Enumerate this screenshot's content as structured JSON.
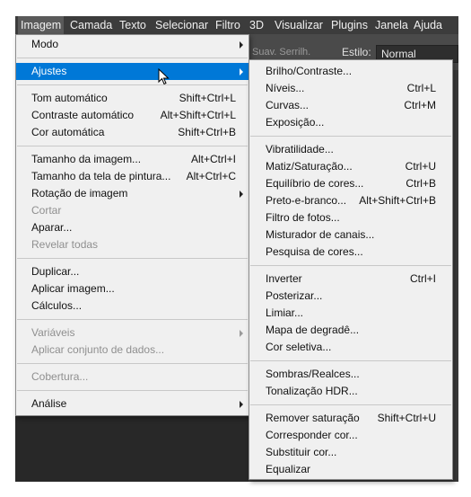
{
  "menubar": {
    "items": [
      "Imagem",
      "Camada",
      "Texto",
      "Selecionar",
      "Filtro",
      "3D",
      "Visualizar",
      "Plugins",
      "Janela",
      "Ajuda"
    ],
    "active_index": 0
  },
  "options_bar": {
    "faded_text": "Suav. Serrilh.",
    "style_label": "Estilo:",
    "style_value": "Normal"
  },
  "image_menu": [
    {
      "label": "Modo",
      "submenu": true
    },
    {
      "separator": true
    },
    {
      "label": "Ajustes",
      "submenu": true,
      "highlighted": true
    },
    {
      "separator": true
    },
    {
      "label": "Tom automático",
      "shortcut": "Shift+Ctrl+L"
    },
    {
      "label": "Contraste automático",
      "shortcut": "Alt+Shift+Ctrl+L"
    },
    {
      "label": "Cor automática",
      "shortcut": "Shift+Ctrl+B"
    },
    {
      "separator": true
    },
    {
      "label": "Tamanho da imagem...",
      "shortcut": "Alt+Ctrl+I"
    },
    {
      "label": "Tamanho da tela de pintura...",
      "shortcut": "Alt+Ctrl+C"
    },
    {
      "label": "Rotação de imagem",
      "submenu": true
    },
    {
      "label": "Cortar",
      "disabled": true
    },
    {
      "label": "Aparar..."
    },
    {
      "label": "Revelar todas",
      "disabled": true
    },
    {
      "separator": true
    },
    {
      "label": "Duplicar..."
    },
    {
      "label": "Aplicar imagem..."
    },
    {
      "label": "Cálculos..."
    },
    {
      "separator": true
    },
    {
      "label": "Variáveis",
      "submenu": true,
      "disabled": true
    },
    {
      "label": "Aplicar conjunto de dados...",
      "disabled": true
    },
    {
      "separator": true
    },
    {
      "label": "Cobertura...",
      "disabled": true
    },
    {
      "separator": true
    },
    {
      "label": "Análise",
      "submenu": true
    }
  ],
  "adjustments_menu": [
    {
      "label": "Brilho/Contraste..."
    },
    {
      "label": "Níveis...",
      "shortcut": "Ctrl+L"
    },
    {
      "label": "Curvas...",
      "shortcut": "Ctrl+M"
    },
    {
      "label": "Exposição..."
    },
    {
      "separator": true
    },
    {
      "label": "Vibratilidade..."
    },
    {
      "label": "Matiz/Saturação...",
      "shortcut": "Ctrl+U"
    },
    {
      "label": "Equilíbrio de cores...",
      "shortcut": "Ctrl+B"
    },
    {
      "label": "Preto-e-branco...",
      "shortcut": "Alt+Shift+Ctrl+B"
    },
    {
      "label": "Filtro de fotos..."
    },
    {
      "label": "Misturador de canais..."
    },
    {
      "label": "Pesquisa de cores..."
    },
    {
      "separator": true
    },
    {
      "label": "Inverter",
      "shortcut": "Ctrl+I"
    },
    {
      "label": "Posterizar..."
    },
    {
      "label": "Limiar..."
    },
    {
      "label": "Mapa de degradê..."
    },
    {
      "label": "Cor seletiva..."
    },
    {
      "separator": true
    },
    {
      "label": "Sombras/Realces..."
    },
    {
      "label": "Tonalização HDR..."
    },
    {
      "separator": true
    },
    {
      "label": "Remover saturação",
      "shortcut": "Shift+Ctrl+U"
    },
    {
      "label": "Corresponder cor..."
    },
    {
      "label": "Substituir cor..."
    },
    {
      "label": "Equalizar"
    }
  ],
  "colors": {
    "menubar_bg": "#3c3c3c",
    "menu_bg": "#f0f0f0",
    "highlight": "#0078d7",
    "disabled_text": "#8f8f8f"
  }
}
